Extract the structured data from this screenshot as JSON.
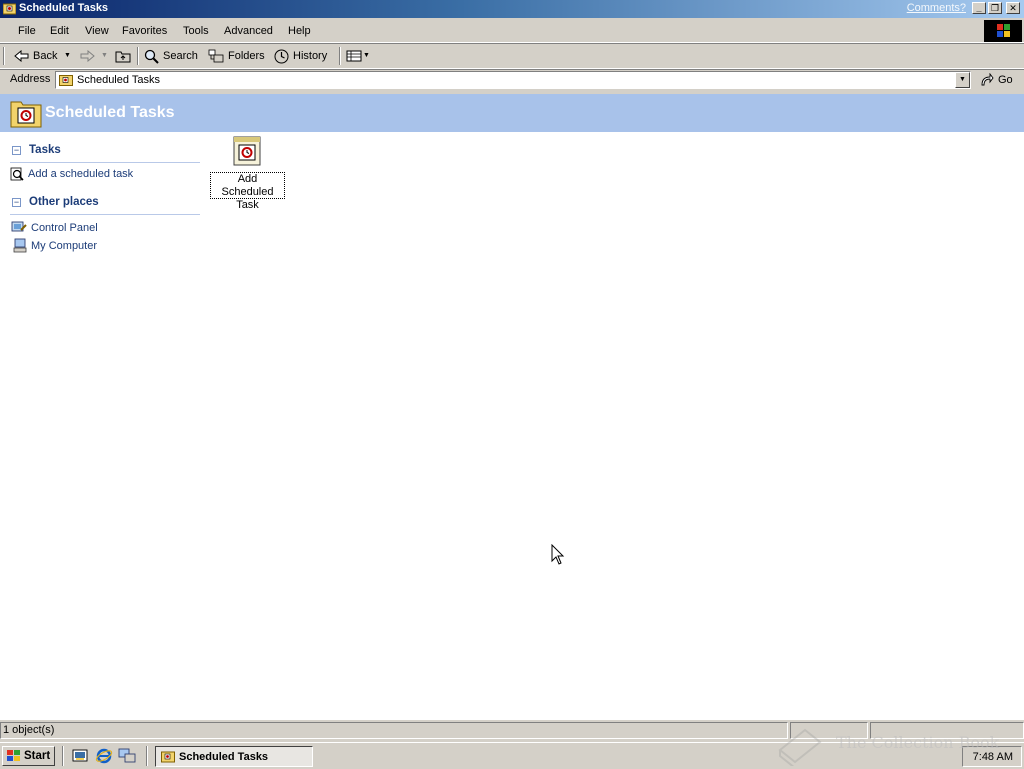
{
  "window": {
    "title": "Scheduled Tasks",
    "comments_link": "Comments?",
    "controls": {
      "minimize": "_",
      "maximize": "❐",
      "close": "✕"
    }
  },
  "menu": [
    "File",
    "Edit",
    "View",
    "Favorites",
    "Tools",
    "Advanced",
    "Help"
  ],
  "toolbar": {
    "back": "Back",
    "search": "Search",
    "folders": "Folders",
    "history": "History"
  },
  "address": {
    "label": "Address",
    "value": "Scheduled Tasks",
    "go": "Go"
  },
  "banner": {
    "title": "Scheduled Tasks"
  },
  "sidebar": {
    "tasks": {
      "title": "Tasks",
      "items": [
        "Add a scheduled task"
      ]
    },
    "other_places": {
      "title": "Other places",
      "items": [
        "Control Panel",
        "My Computer"
      ]
    }
  },
  "content": {
    "items": [
      {
        "line1": "Add Scheduled",
        "line2": "Task",
        "icon": "scheduled-task-icon"
      }
    ]
  },
  "status": {
    "text": "1 object(s)"
  },
  "taskbar": {
    "start": "Start",
    "active_window": "Scheduled Tasks",
    "clock": "7:48 AM"
  },
  "watermark": "The Collection Book",
  "colors": {
    "title_start": "#0a246a",
    "title_end": "#a6caf0",
    "banner": "#a8c2ea",
    "link": "#1c3c78"
  }
}
